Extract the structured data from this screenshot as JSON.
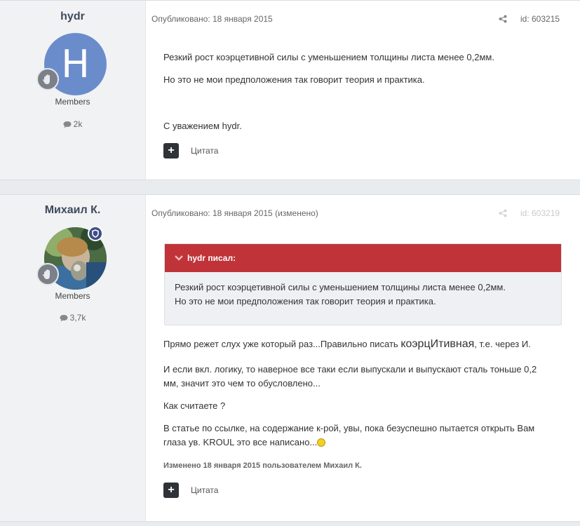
{
  "posts": [
    {
      "author": "hydr",
      "avatar_letter": "H",
      "avatar_color": "#6b8ccb",
      "group": "Members",
      "count": "2k",
      "meta": "Опубликовано: 18 января 2015",
      "post_id": "id: 603215",
      "paragraphs": [
        "Резкий рост коэрцетивной силы с уменьшением толщины листа менее 0,2мм.",
        "Но это не мои предположения так говорит теория и практика.",
        "С уважением hydr."
      ],
      "quote_label": "Цитата"
    },
    {
      "author": "Михаил К.",
      "group": "Members",
      "count": "3,7k",
      "meta": "Опубликовано: 18 января 2015 (изменено)",
      "post_id": "id: 603219",
      "quote": {
        "header": "hydr писал:",
        "line1": "Резкий рост коэрцетивной силы с уменьшением толщины листа менее 0,2мм.",
        "line2": "Но это не мои предположения так говорит теория и практика.",
        "header_color": "#bf3339"
      },
      "p1_before": "Прямо режет слух уже который раз...Правильно писать ",
      "p1_word": "коэрцИтивная",
      "p1_after": ", т.е. через И.",
      "p2": "И если вкл. логику, то наверное все таки если выпускали и выпускают сталь тоньше 0,2 мм, значит это чем то обусловлено...",
      "p3": "Как считаете ?",
      "p4": "В статье по ссылке, на содержание к-рой, увы, пока безуспешно пытается открыть Вам глаза ув. KROUL это все написано...",
      "edited": "Изменено 18 января 2015 пользователем Михаил К.",
      "quote_label": "Цитата"
    }
  ]
}
